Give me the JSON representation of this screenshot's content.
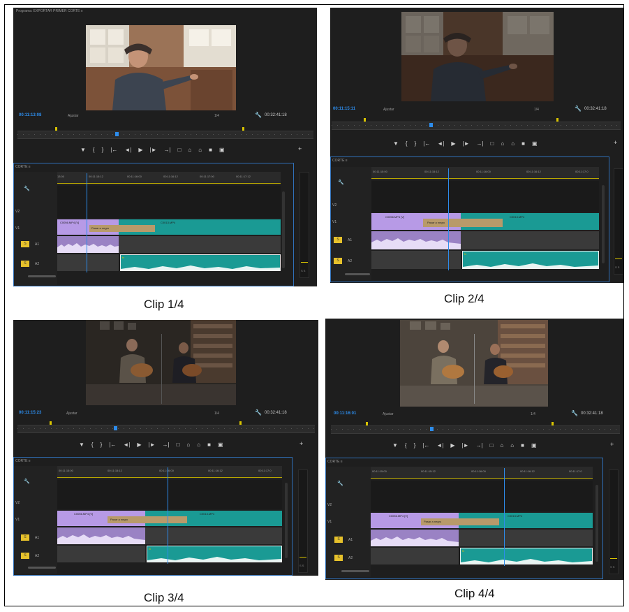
{
  "monitor_title": "Programa: EXPORTAR PRIMER CORTE  ≡",
  "fit_label": "Ajustar",
  "resolution": "1/4",
  "duration": "00:32:41:18",
  "seq_title": "CORTE  ≡",
  "clip_a_label": "C0056.MP4 [V]",
  "fade_label": "Pasar a negro",
  "clip_b_label": "C0013.MP4",
  "fx_label": "fx",
  "track_labels": [
    "V2",
    "V1",
    "A1",
    "A2"
  ],
  "toggle_labels": [
    "S",
    "S"
  ],
  "meter_label": "S  S",
  "transport_icons": [
    "▼",
    "{",
    "}",
    "|←",
    "◄|",
    "▶",
    "|►",
    "→|",
    "□",
    "⌂",
    "⌂",
    "■",
    "▣"
  ],
  "plus_icon": "+",
  "wrench_icon": "🔧",
  "colors": {
    "accent_blue": "#2d8ceb",
    "clip_purple": "#b79ae6",
    "clip_teal": "#1a9a94",
    "fade_tan": "#b89a6a",
    "marker_yellow": "#d9c400"
  },
  "panels": [
    {
      "id": "p1",
      "timecode": "00:11:13:08",
      "caption": "Clip 1/4",
      "ruler_labels": [
        "13:00",
        "00:11:15:12",
        "00:11:16:00",
        "00:11:16:12",
        "00:11:17:00",
        "00:11:17:12"
      ]
    },
    {
      "id": "p2",
      "timecode": "00:11:15:11",
      "caption": "Clip 2/4",
      "ruler_labels": [
        "00:11:15:00",
        "00:11:15:12",
        "00:11:16:00",
        "00:11:16:12",
        "00:11:17:0"
      ]
    },
    {
      "id": "p3",
      "timecode": "00:11:15:23",
      "caption": "Clip 3/4",
      "ruler_labels": [
        "00:11:15:00",
        "00:11:15:12",
        "00:11:16:00",
        "00:11:16:12",
        "00:11:17:0"
      ]
    },
    {
      "id": "p4",
      "timecode": "00:11:16:01",
      "caption": "Clip 4/4",
      "ruler_labels": [
        "00:11:15:00",
        "00:11:15:12",
        "00:11:16:00",
        "00:11:16:12",
        "00:11:17:0"
      ]
    }
  ]
}
